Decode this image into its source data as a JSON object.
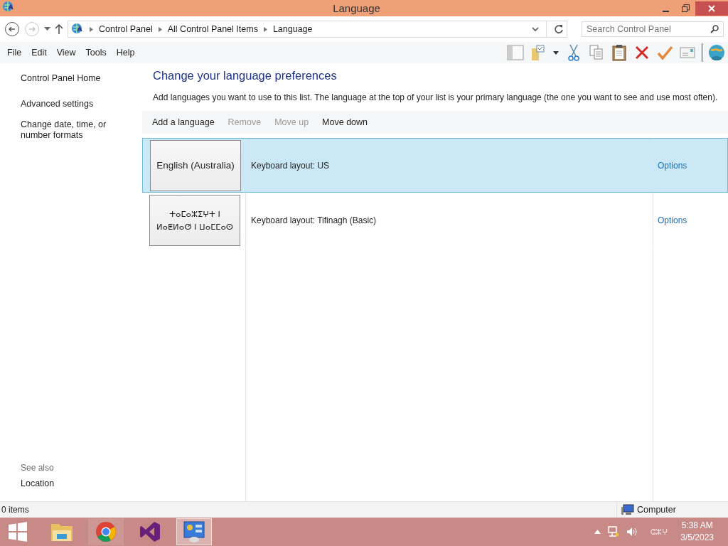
{
  "window": {
    "title": "Language"
  },
  "address_bar": {
    "breadcrumbs": [
      "Control Panel",
      "All Control Panel Items",
      "Language"
    ]
  },
  "search": {
    "placeholder": "Search Control Panel"
  },
  "menu": [
    "File",
    "Edit",
    "View",
    "Tools",
    "Help"
  ],
  "sidebar": {
    "items": [
      "Control Panel Home",
      "Advanced settings",
      "Change date, time, or number formats"
    ],
    "see_also_heading": "See also",
    "see_also": [
      "Location"
    ]
  },
  "heading": "Change your language preferences",
  "description": "Add languages you want to use to this list. The language at the top of your list is your primary language (the one you want to see and use most often).",
  "actions": [
    {
      "label": "Add a language",
      "disabled": false
    },
    {
      "label": "Remove",
      "disabled": true
    },
    {
      "label": "Move up",
      "disabled": true
    },
    {
      "label": "Move down",
      "disabled": false
    }
  ],
  "languages": [
    {
      "name": "English (Australia)",
      "keyboard": "Keyboard layout: US",
      "options": "Options",
      "selected": true
    },
    {
      "name": "ⵜⴰⵎⴰⵣⵉⵖⵜ ⵏ ⵍⴰⵟⵍⴰⵚ ⵏ ⵡⴰⵎⵎⴰⵙ",
      "keyboard": "Keyboard layout: Tifinagh (Basic)",
      "options": "Options",
      "selected": false
    }
  ],
  "status_bar": {
    "items": "0 items",
    "location": "Computer"
  },
  "taskbar": {
    "input_indicator": "ⵛⵣⵖ",
    "time": "5:38 AM",
    "date": "3/5/2023"
  }
}
